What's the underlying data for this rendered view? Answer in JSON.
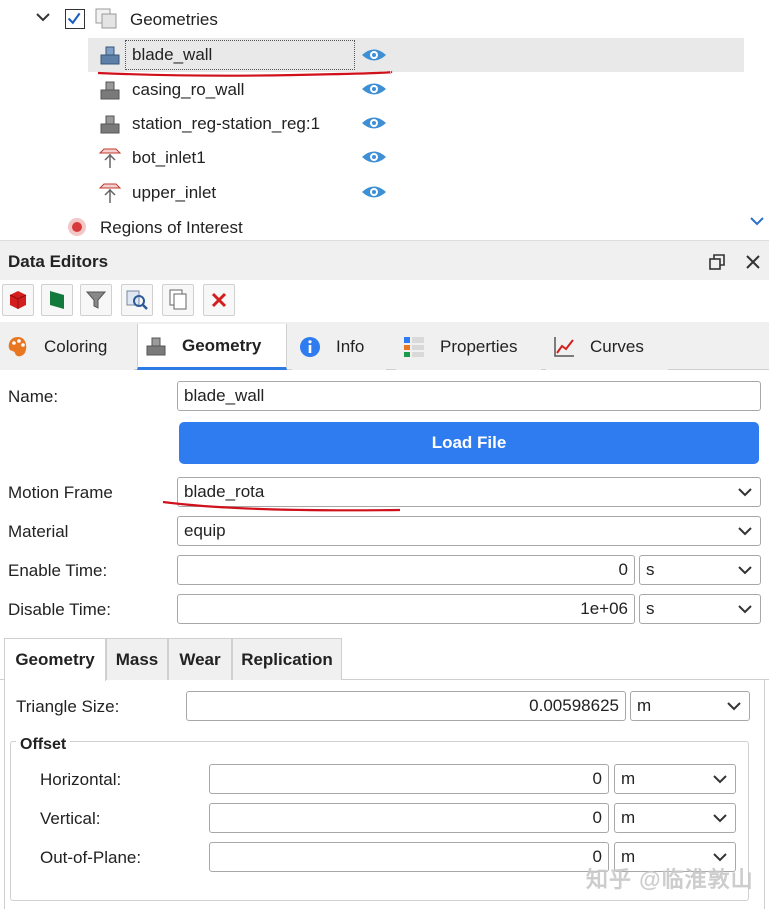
{
  "tree": {
    "root_label": "Geometries",
    "items": [
      {
        "label": "blade_wall",
        "icon": "solid-geometry-icon"
      },
      {
        "label": "casing_ro_wall",
        "icon": "solid-geometry-icon"
      },
      {
        "label": "station_reg-station_reg:1",
        "icon": "solid-geometry-icon"
      },
      {
        "label": "bot_inlet1",
        "icon": "inlet-geometry-icon"
      },
      {
        "label": "upper_inlet",
        "icon": "inlet-geometry-icon"
      }
    ],
    "next_group_label": "Regions of Interest"
  },
  "data_editors": {
    "title": "Data Editors"
  },
  "tabs": [
    {
      "label": "Coloring",
      "icon": "palette-icon"
    },
    {
      "label": "Geometry",
      "icon": "geometry-icon"
    },
    {
      "label": "Info",
      "icon": "info-icon"
    },
    {
      "label": "Properties",
      "icon": "properties-icon"
    },
    {
      "label": "Curves",
      "icon": "curves-icon"
    }
  ],
  "form": {
    "name_label": "Name:",
    "name_value": "blade_wall",
    "load_file_label": "Load File",
    "motion_frame_label": "Motion Frame",
    "motion_frame_value": "blade_rota",
    "material_label": "Material",
    "material_value": "equip",
    "enable_time_label": "Enable Time:",
    "enable_time_value": "0",
    "enable_time_unit": "s",
    "disable_time_label": "Disable Time:",
    "disable_time_value": "1e+06",
    "disable_time_unit": "s"
  },
  "subtabs": [
    {
      "label": "Geometry"
    },
    {
      "label": "Mass"
    },
    {
      "label": "Wear"
    },
    {
      "label": "Replication"
    }
  ],
  "geometry_panel": {
    "triangle_size_label": "Triangle Size:",
    "triangle_size_value": "0.00598625",
    "triangle_size_unit": "m",
    "offset_title": "Offset",
    "horizontal_label": "Horizontal:",
    "horizontal_value": "0",
    "horizontal_unit": "m",
    "vertical_label": "Vertical:",
    "vertical_value": "0",
    "vertical_unit": "m",
    "out_of_plane_label": "Out-of-Plane:",
    "out_of_plane_value": "0",
    "out_of_plane_unit": "m"
  },
  "watermark": "知乎 @临淮敦山",
  "colors": {
    "accent": "#2f7bf0",
    "eye": "#3d8fd6",
    "annotation": "#d0101a"
  }
}
